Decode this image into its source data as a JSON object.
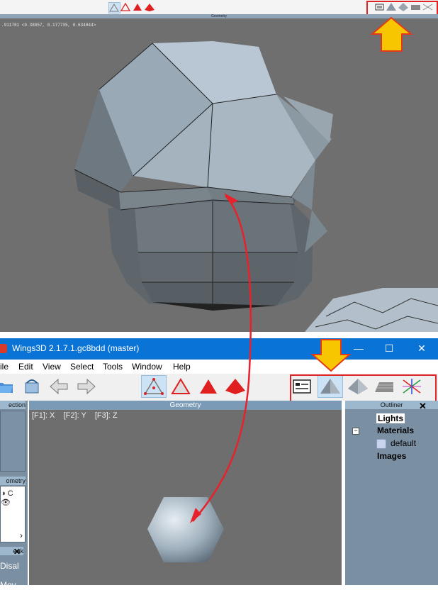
{
  "top": {
    "geometry_label": "Geometry",
    "coords": ".911781  <0.38057, 0.177735, 0.634844>"
  },
  "window": {
    "title": "Wings3D 2.1.7.1.gc8bdd (master)",
    "minimize": "—",
    "maximize": "☐",
    "close": "✕"
  },
  "menu": {
    "file": "ile",
    "edit": "Edit",
    "view": "View",
    "select": "Select",
    "tools": "Tools",
    "window": "Window",
    "help": "Help"
  },
  "left_panel": {
    "selection_header": "ection",
    "geometry_header": "ometry",
    "geometry_row": "C",
    "scroll_right": "›",
    "tweak_header": "eak",
    "tweak_item1": "Disal",
    "tweak_item2": "Mov"
  },
  "viewport": {
    "header": "Geometry",
    "fkeys": "[F1]: X    [F2]: Y    [F3]: Z"
  },
  "outliner": {
    "header": "Outliner",
    "lights": "Lights",
    "materials": "Materials",
    "default": "default",
    "images": "Images",
    "collapse": "−",
    "close": "✕"
  },
  "colors": {
    "titlebar": "#0a74d6",
    "highlight_box": "#e02424",
    "arrow": "#f7c600",
    "annotation_line": "#e8222a",
    "panel_bg": "#7b8fa3",
    "viewport_bg": "#6e6e6e"
  }
}
